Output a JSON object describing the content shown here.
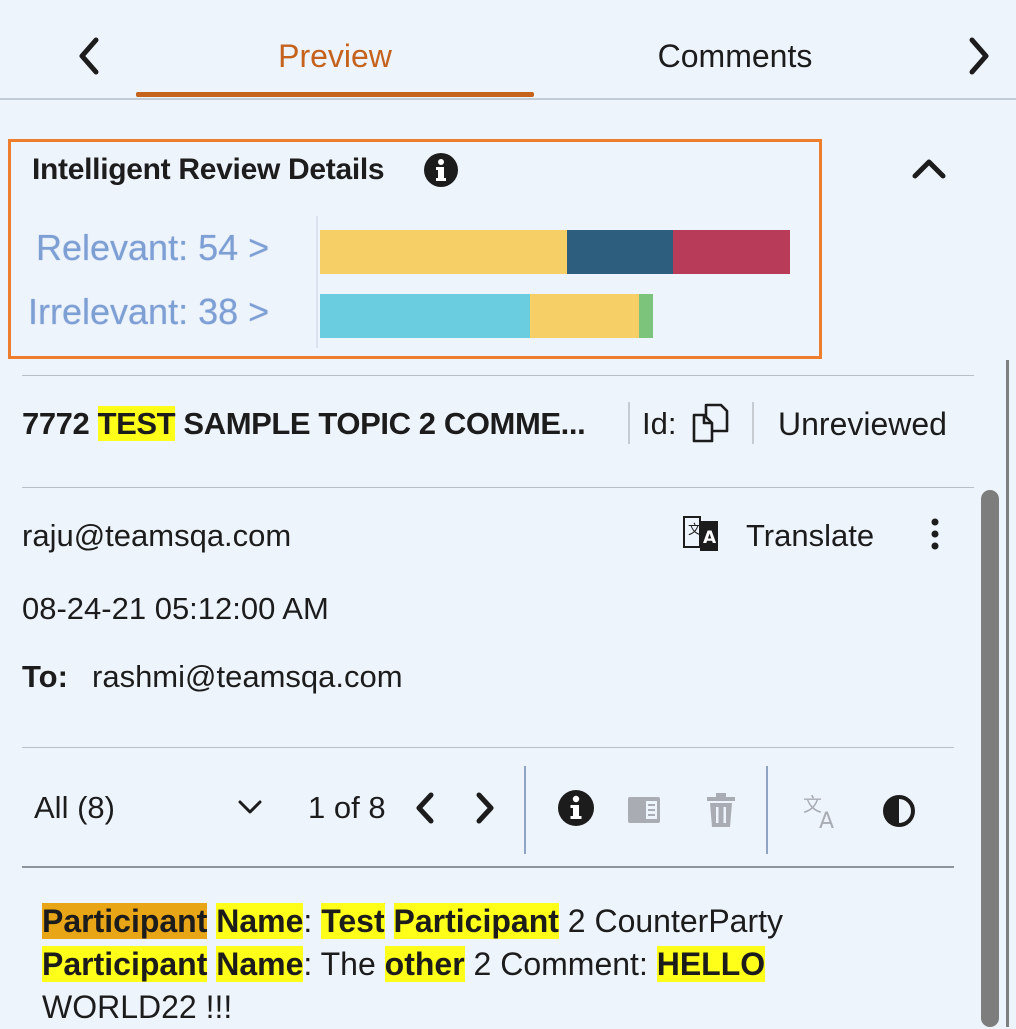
{
  "tabs": {
    "preview_label": "Preview",
    "comments_label": "Comments"
  },
  "intelligent_review": {
    "title": "Intelligent Review Details",
    "rows": [
      {
        "label": "Relevant: 54 >",
        "segments": [
          {
            "color": "#f6cf67",
            "fraction": 0.525
          },
          {
            "color": "#2e5e7e",
            "fraction": 0.225
          },
          {
            "color": "#b83c5a",
            "fraction": 0.25
          }
        ]
      },
      {
        "label": "Irrelevant: 38 >",
        "segments": [
          {
            "color": "#6acde0",
            "fraction": 0.631
          },
          {
            "color": "#f6cf67",
            "fraction": 0.328
          },
          {
            "color": "#7cc47b",
            "fraction": 0.041
          }
        ]
      }
    ]
  },
  "document": {
    "title_prefix": "7772 ",
    "title_highlight": "TEST",
    "title_suffix": " SAMPLE TOPIC 2 COMME...",
    "id_label": "Id:",
    "status": "Unreviewed"
  },
  "email": {
    "from": "raju@teamsqa.com",
    "translate_label": "Translate",
    "date": "08-24-21 05:12:00 AM",
    "to_label": "To:",
    "to_value": "rashmi@teamsqa.com"
  },
  "toolbar": {
    "filter_value": "All (8)",
    "pager": "1 of 8"
  },
  "content": {
    "w_participant": "Participant",
    "w_name": "Name",
    "w_test": "Test",
    "w_other": "other",
    "w_hello": "HELLO",
    "t_colon": ":",
    "t_counterparty": " 2 CounterParty",
    "t_the": ": The ",
    "t_comment": " 2 Comment: ",
    "t_world": "WORLD22 !!!"
  },
  "colors": {
    "accent": "#c5621c",
    "box_border": "#ee7d2d",
    "highlight": "#ffff1a",
    "highlight_active": "#e8a515"
  }
}
